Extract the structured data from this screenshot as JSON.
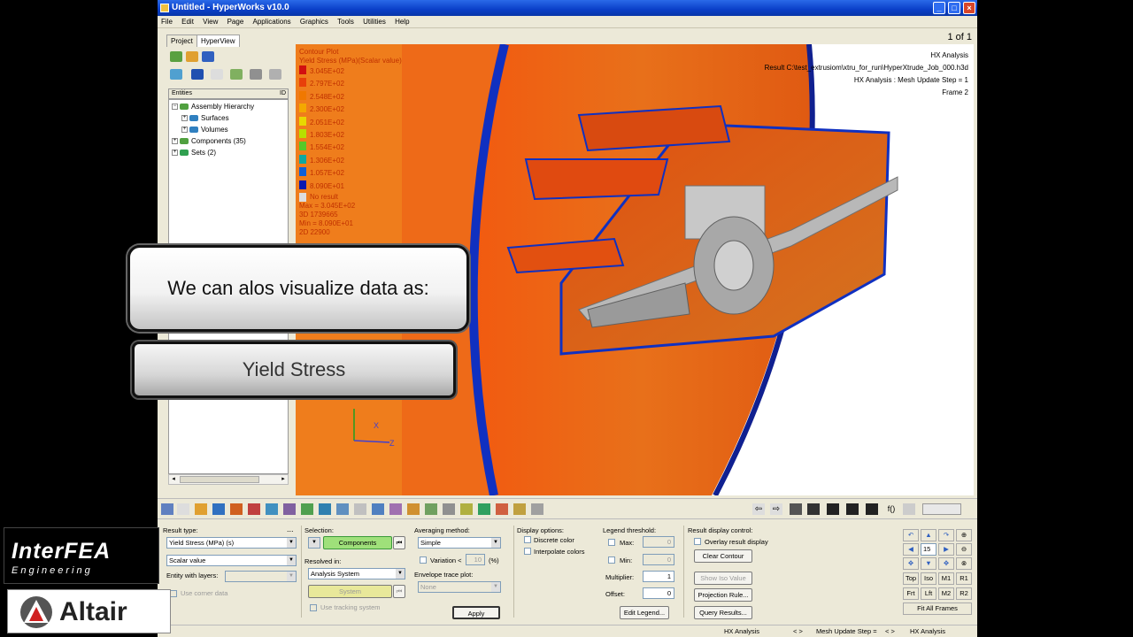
{
  "window": {
    "title": "Untitled - HyperWorks v10.0",
    "buttons": [
      "_",
      "□",
      "×"
    ]
  },
  "menu": [
    "File",
    "Edit",
    "View",
    "Page",
    "Applications",
    "Graphics",
    "Tools",
    "Utilities",
    "Help"
  ],
  "tabs": {
    "project": "Project",
    "hyperview": "HyperView"
  },
  "entity_header": {
    "label": "Entities",
    "col2": "ID"
  },
  "tree": [
    {
      "label": "Assembly Hierarchy"
    },
    {
      "label": "Surfaces"
    },
    {
      "label": "Volumes"
    },
    {
      "label": "Components (35)"
    },
    {
      "label": "Sets (2)"
    }
  ],
  "viewport": {
    "page_counter": "1 of 1",
    "legend_title1": "Contour Plot",
    "legend_title2": "Yield Stress (MPa)(Scalar value)",
    "legend_values": [
      "3.045E+02",
      "2.797E+02",
      "2.548E+02",
      "2.300E+02",
      "2.051E+02",
      "1.803E+02",
      "1.554E+02",
      "1.306E+02",
      "1.057E+02",
      "8.090E+01"
    ],
    "legend_colors": [
      "#d21010",
      "#e8400a",
      "#f07800",
      "#f4a800",
      "#e8d800",
      "#b8e000",
      "#58c828",
      "#10a8a0",
      "#1060d8",
      "#0818b0"
    ],
    "no_result": "No result",
    "max_line": "Max = 3.045E+02",
    "max_id": "3D 1739665",
    "min_line": "Min = 8.090E+01",
    "min_id": "2D 22900",
    "analysis_type": "HX Analysis",
    "result_line": "Result   C:\\test_extrusiom\\xtru_for_run\\HyperXtrude_Job_000.h3d",
    "step_line": "HX Analysis : Mesh Update Step = 1",
    "frame_line": "Frame 2",
    "triad_x": "X",
    "triad_z": "Z"
  },
  "panel": {
    "result_type_label": "Result type:",
    "result_type_value": "Yield Stress (MPa) (s)",
    "scalar_value": "Scalar value",
    "entity_layers_label": "Entity with layers:",
    "use_corner_data": "Use corner data",
    "selection_label": "Selection:",
    "components_btn": "Components",
    "resolved_label": "Resolved in:",
    "resolved_value": "Analysis System",
    "system_btn": "System",
    "use_tracking": "Use tracking system",
    "averaging_label": "Averaging method:",
    "averaging_value": "Simple",
    "variation_label": "Variation <",
    "variation_value": "10",
    "variation_unit": "(%)",
    "envelope_label": "Envelope trace plot:",
    "envelope_value": "None",
    "apply_btn": "Apply",
    "display_label": "Display options:",
    "discrete_color": "Discrete color",
    "interpolate_colors": "Interpolate colors",
    "threshold_label": "Legend threshold:",
    "max_label": "Max:",
    "max_value": "0",
    "min_label": "Min:",
    "min_value": "0",
    "multiplier_label": "Multiplier:",
    "multiplier_value": "1",
    "offset_label": "Offset:",
    "offset_value": "0",
    "edit_legend_btn": "Edit Legend...",
    "result_display_label": "Result display control:",
    "overlay_label": "Overlay result display",
    "clear_contour_btn": "Clear Contour",
    "show_iso_btn": "Show Iso Value",
    "projection_btn": "Projection Rule...",
    "query_btn": "Query Results...",
    "zoom_value": "15",
    "view_buttons": [
      "Top",
      "Iso",
      "M1",
      "R1",
      "Frt",
      "Lft",
      "M2",
      "R2"
    ],
    "fit_all": "Fit All Frames"
  },
  "statusbar": {
    "left": "HX Analysis",
    "mid": "Mesh Update Step =",
    "right": "HX Analysis"
  },
  "overlay": {
    "callout1": "We can alos visualize data as:",
    "callout2": "Yield Stress"
  },
  "logos": {
    "interfea_main": "InterFEA",
    "interfea_sub": "Engineering",
    "altair": "Altair"
  }
}
